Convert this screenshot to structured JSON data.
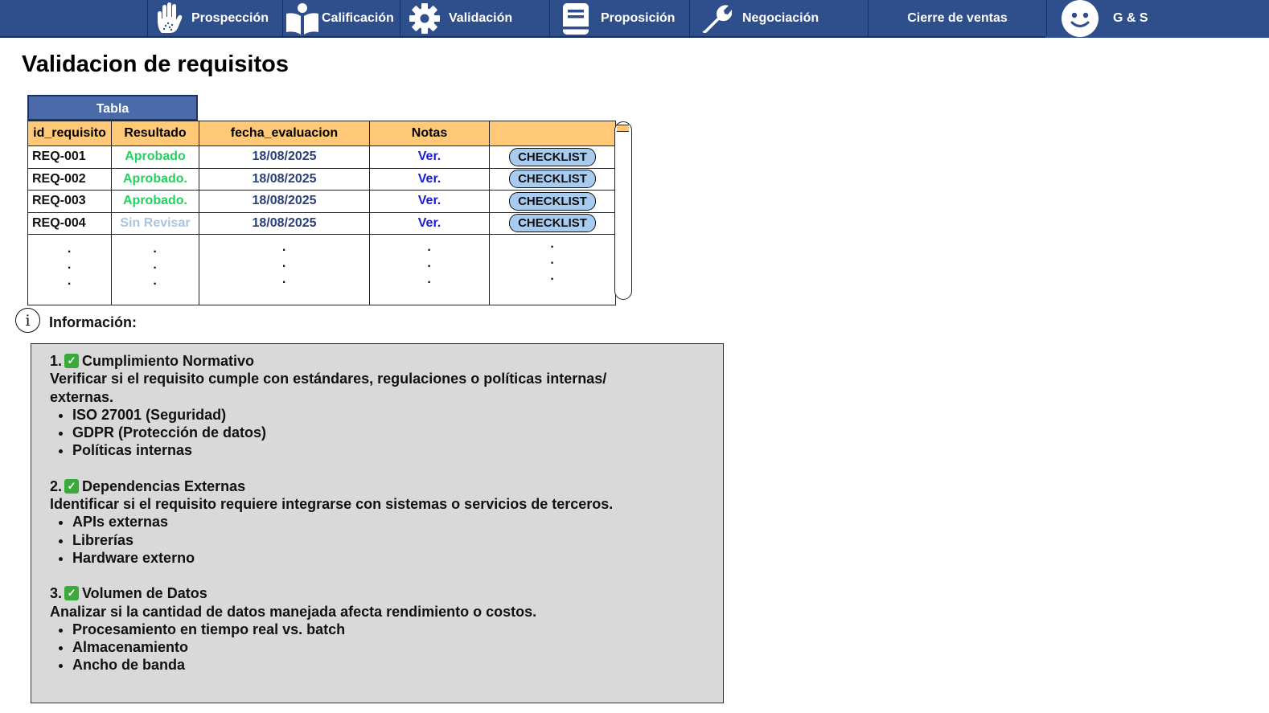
{
  "nav": {
    "items": [
      {
        "label": "Prospección",
        "icon": "hand-icon"
      },
      {
        "label": "Calificación",
        "icon": "open-book-icon"
      },
      {
        "label": "Validación",
        "icon": "gear-icon"
      },
      {
        "label": "Proposición",
        "icon": "notebook-icon"
      },
      {
        "label": "Negociación",
        "icon": "wrench-icon"
      },
      {
        "label": "Cierre de ventas",
        "icon": ""
      },
      {
        "label": "G & S",
        "icon": "smiley-icon"
      }
    ],
    "bar_color": "#2f4e8c"
  },
  "page": {
    "title": "Validacion de requisitos"
  },
  "table": {
    "tab_label": "Tabla",
    "headers": [
      "id_requisito",
      "Resultado",
      "fecha_evaluacion",
      "Notas",
      ""
    ],
    "rows": [
      {
        "id": "REQ-001",
        "result": "Aprobado",
        "status": "ok",
        "date": "18/08/2025",
        "notes": "Ver.",
        "action": "CHECKLIST"
      },
      {
        "id": "REQ-002",
        "result": "Aprobado.",
        "status": "ok",
        "date": "18/08/2025",
        "notes": "Ver.",
        "action": "CHECKLIST"
      },
      {
        "id": "REQ-003",
        "result": "Aprobado.",
        "status": "ok",
        "date": "18/08/2025",
        "notes": "Ver.",
        "action": "CHECKLIST"
      },
      {
        "id": "REQ-004",
        "result": "Sin Revisar",
        "status": "pending",
        "date": "18/08/2025",
        "notes": "Ver.",
        "action": "CHECKLIST"
      }
    ],
    "ellipsis": "·",
    "header_color": "#ffc978",
    "approved_color": "#1fd45a",
    "pending_color": "#a9c4e0"
  },
  "info": {
    "label": "Información:",
    "sections": [
      {
        "number": "1.",
        "title": "Cumplimiento Normativo",
        "desc": "Verificar si el requisito cumple con estándares, regulaciones o políticas internas/ externas.",
        "items": [
          "ISO 27001 (Seguridad)",
          "GDPR (Protección de datos)",
          "Políticas internas"
        ]
      },
      {
        "number": "2.",
        "title": "Dependencias Externas",
        "desc": "Identificar si el requisito requiere integrarse con sistemas o servicios de terceros.",
        "items": [
          "APIs externas",
          "Librerías",
          "Hardware externo"
        ]
      },
      {
        "number": "3.",
        "title": "Volumen de Datos",
        "desc": "Analizar si la cantidad de datos manejada afecta rendimiento o costos.",
        "items": [
          "Procesamiento en tiempo real vs. batch",
          "Almacenamiento",
          "Ancho de banda"
        ]
      }
    ]
  }
}
